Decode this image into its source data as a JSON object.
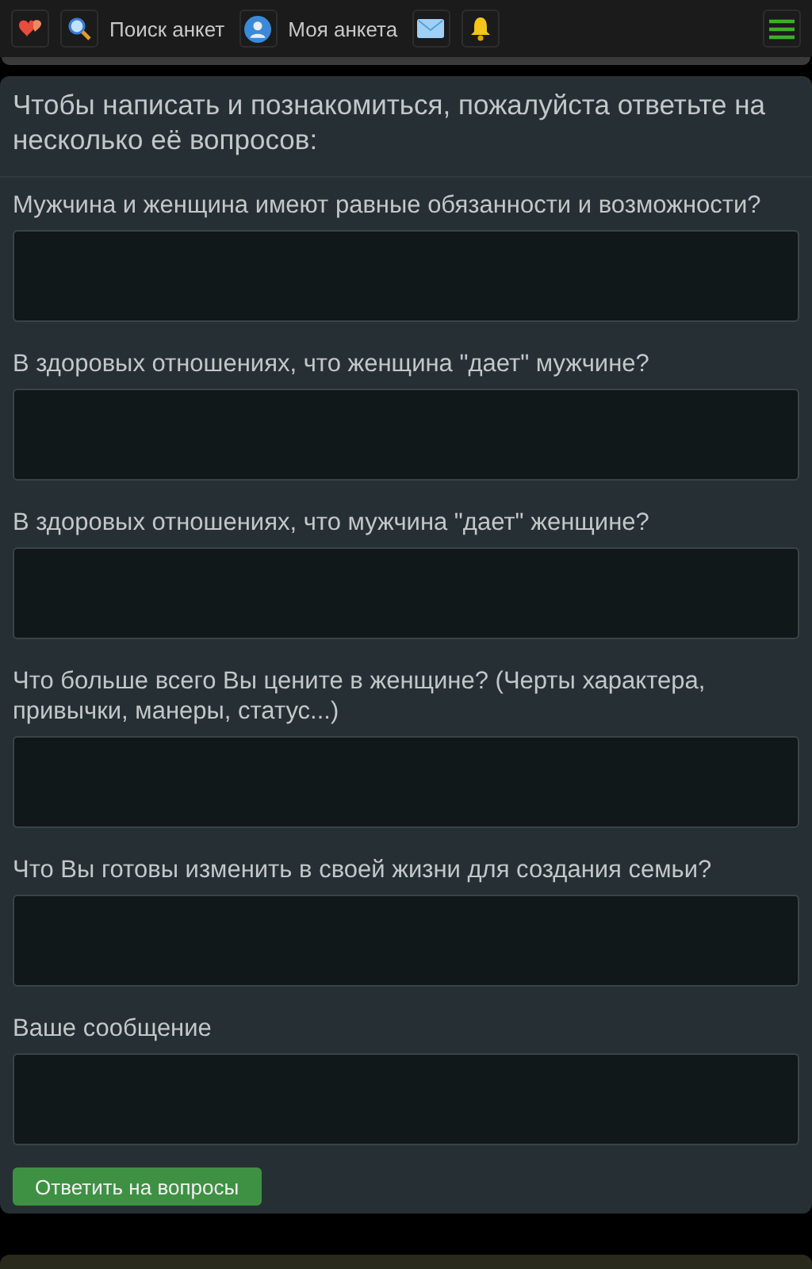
{
  "nav": [
    {
      "kind": "favorites"
    },
    {
      "kind": "search",
      "label": "Поиск анкет"
    },
    {
      "kind": "profile",
      "label": "Моя анкета"
    },
    {
      "kind": "messages"
    },
    {
      "kind": "notifications"
    },
    {
      "kind": "menu"
    }
  ],
  "form": {
    "intro": "Чтобы написать и познакомиться, пожалуйста ответьте на несколько её вопросов:",
    "questions": [
      {
        "label": "Мужчина и женщина имеют равные обязанности и возможности?"
      },
      {
        "label": "В здоровых отношениях, что женщина \"дает\" мужчине?"
      },
      {
        "label": "В здоровых отношениях, что мужчина \"дает\" женщине?"
      },
      {
        "label": "Что больше всего Вы цените в женщине? (Черты характера, привычки, манеры, статус...)"
      },
      {
        "label": "Что Вы готовы изменить в своей жизни для создания семьи?"
      },
      {
        "label": "Ваше сообщение"
      }
    ],
    "submit": "Ответить на вопросы"
  }
}
